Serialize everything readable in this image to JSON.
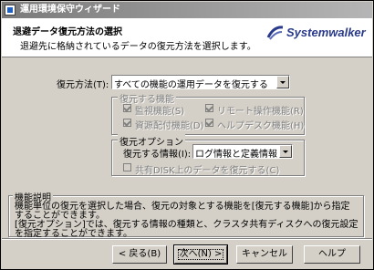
{
  "window": {
    "title": "運用環境保守ウィザード"
  },
  "header": {
    "title": "退避データ復元方法の選択",
    "subtitle": "退避先に格納されているデータの復元方法を選択します。",
    "logo_text": "Systemwalker"
  },
  "restore_method": {
    "label": "復元方法(T):",
    "value": "すべての機能の運用データを復元する"
  },
  "functions_group": {
    "legend": "復元する機能",
    "items": [
      {
        "label": "監視機能(S)",
        "checked": true
      },
      {
        "label": "リモート操作機能(R)",
        "checked": true
      },
      {
        "label": "資源配付機能(D)",
        "checked": true
      },
      {
        "label": "ヘルプデスク機能(H)",
        "checked": true
      }
    ]
  },
  "options_group": {
    "legend": "復元オプション",
    "info_label": "復元する情報(I):",
    "info_value": "ログ情報と定義情報",
    "shared_disk_label": "共有DISK上のデータを復元する(C)"
  },
  "description": {
    "legend": "機能説明",
    "lines": [
      "機能単位の復元を選択した場合、復元の対象とする機能を[復元する機能]から指定",
      "することができます。",
      "[復元オプション]では、復元する情報の種類と、クラスタ共有ディスクへの復元設定",
      "を指定することができます。"
    ]
  },
  "buttons": {
    "back": "< 戻る(B)",
    "next": "次へ(N) >",
    "cancel": "キャンセル",
    "help": "ヘルプ"
  },
  "colors": {
    "logo": "#2a3a8a",
    "titlebar": "#8a8a8a"
  }
}
